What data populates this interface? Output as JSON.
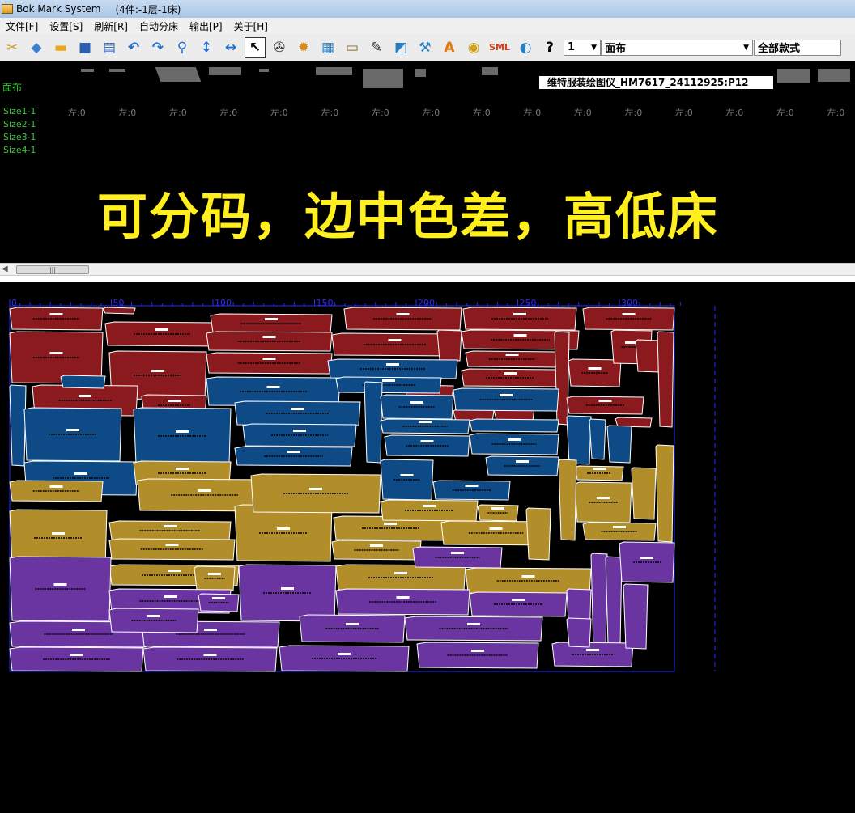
{
  "window": {
    "app_title": "Bok Mark System",
    "subtitle": "(4件:-1层-1床)"
  },
  "menu": [
    "文件[F]",
    "设置[S]",
    "刷新[R]",
    "自动分床",
    "输出[P]",
    "关于[H]"
  ],
  "toolbar": {
    "icons": [
      "scissors-icon",
      "fabric-icon",
      "open-folder-icon",
      "save-icon",
      "insert-icon",
      "undo-icon",
      "redo-icon",
      "zoom-icon",
      "flip-vertical-icon",
      "flip-horizontal-icon",
      "cursor-icon",
      "reel-icon",
      "pattern-icon",
      "ruler-icon",
      "print-icon",
      "knife-icon",
      "plotter-icon",
      "tools-icon",
      "text-icon",
      "disc-icon",
      "sml-icon",
      "globe-icon",
      "help-icon"
    ],
    "text_label": "A",
    "sml_label": "SML",
    "help_label": "?",
    "layer_value": "1",
    "fabric_value": "面布",
    "style_value": "全部款式"
  },
  "top": {
    "fabric_label": "面布",
    "plotter_label": "维特服装绘图仪_HM7617_24112925:P12",
    "sizes": [
      "Size1-1",
      "Size2-1",
      "Size3-1",
      "Size4-1"
    ],
    "left_counts": [
      "左:0",
      "左:0",
      "左:0",
      "左:0",
      "左:0",
      "左:0",
      "左:0",
      "左:0",
      "左:0",
      "左:0",
      "左:0",
      "左:0",
      "左:0",
      "左:0",
      "左:0",
      "左:0"
    ],
    "banner": "可分码，边中色差，高低床"
  },
  "ruler": {
    "ticks": [
      "0",
      "50",
      "100",
      "150",
      "200",
      "250",
      "300"
    ]
  },
  "colors": {
    "size1": "#8b1a1f",
    "size2": "#0e4b86",
    "size3": "#b28e2a",
    "size4": "#6a35a0",
    "ruler": "#2a2aff"
  }
}
